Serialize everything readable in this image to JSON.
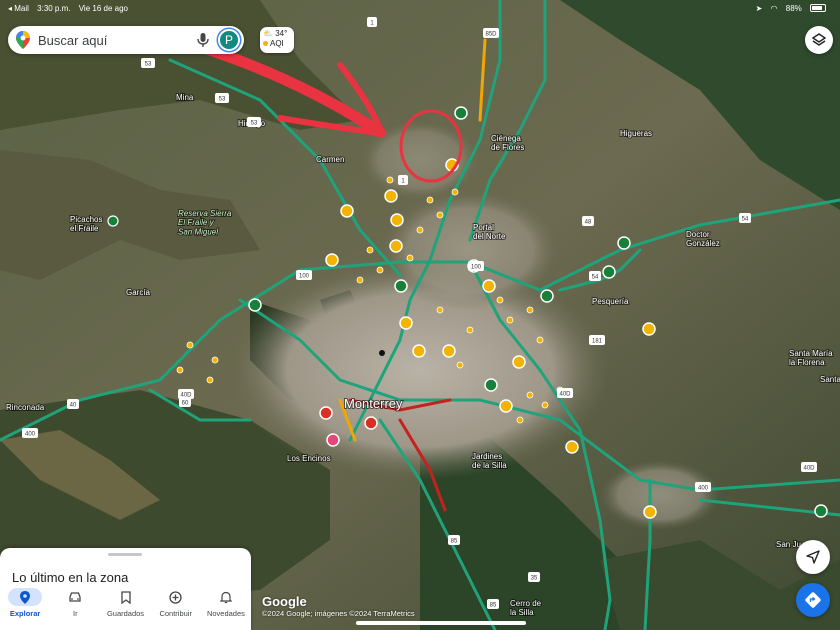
{
  "status_bar": {
    "back_app": "◂ Mail",
    "time": "3:30 p.m.",
    "date": "Vie 16 de ago",
    "battery": "88%"
  },
  "search": {
    "placeholder": "Buscar aquí",
    "avatar_letter": "P"
  },
  "weather": {
    "temp": "34°",
    "aqi": "AQI"
  },
  "bottom_sheet": {
    "title": "Lo último en la zona",
    "tabs": [
      {
        "label": "Explorar",
        "icon": "pin-icon",
        "active": true
      },
      {
        "label": "Ir",
        "icon": "car-icon",
        "active": false
      },
      {
        "label": "Guardados",
        "icon": "bookmark-icon",
        "active": false
      },
      {
        "label": "Contribuir",
        "icon": "add-circle-icon",
        "active": false
      },
      {
        "label": "Novedades",
        "icon": "bell-icon",
        "active": false
      }
    ]
  },
  "map": {
    "logo": "Google",
    "copyright": "©2024 Google; imágenes ©2024 TerraMetrics",
    "places": {
      "monterrey": "Monterrey",
      "carmen": "Carmen",
      "hidalgo": "Hidalgo",
      "mina": "Mina",
      "cienega": "Ciénega\nde Flores",
      "higueras": "Higueras",
      "picachos": "Picachos\nel Fraile",
      "reserva": "Reserva Sierra\nEl Fraile y\nSan Miguel",
      "portal": "Portal\ndel Norte",
      "doctor": "Doctor\nGonzález",
      "pesqueria": "Pesquería",
      "garcia": "García",
      "rinconada": "Rinconada",
      "santamaria": "Santa María\nla Florena",
      "losencinos": "Los Encinos",
      "jardines": "Jardines\nde la Silla",
      "cerro": "Cerro de\nla Silla",
      "santa": "Santa",
      "sanju": "San Ju"
    },
    "routes": [
      "53",
      "53",
      "53",
      "85D",
      "1",
      "1",
      "100",
      "100",
      "48",
      "54",
      "54",
      "181",
      "40",
      "400",
      "400",
      "40D",
      "40D",
      "85",
      "85",
      "35",
      "60",
      "40D"
    ]
  },
  "colors": {
    "highway": "#1fa37a",
    "traffic_heavy": "#c5221f",
    "traffic_medium": "#f2a600",
    "annotation": "#ea3340",
    "accent_blue": "#1a73e8"
  }
}
